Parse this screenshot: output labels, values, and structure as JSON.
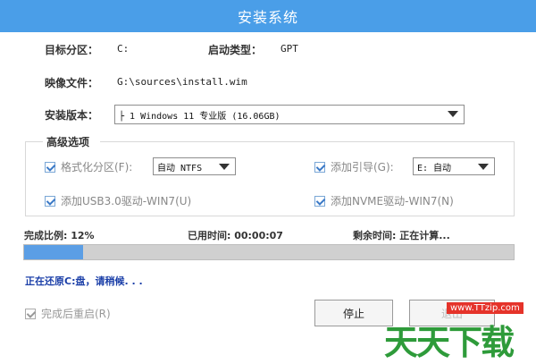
{
  "window": {
    "title": "安装系统"
  },
  "info": {
    "target_label": "目标分区：",
    "target_value": "C:",
    "boot_label": "启动类型：",
    "boot_value": "GPT",
    "image_label": "映像文件：",
    "image_value": "G:\\sources\\install.wim",
    "version_label": "安装版本：",
    "version_value": "├ 1 Windows 11 专业版 (16.06GB)"
  },
  "advanced": {
    "title": "高级选项",
    "format_label": "格式化分区(F):",
    "format_value": "自动 NTFS",
    "boot_add_label": "添加引导(G):",
    "boot_add_value": "E: 自动",
    "usb_label": "添加USB3.0驱动-WIN7(U)",
    "nvme_label": "添加NVME驱动-WIN7(N)"
  },
  "progress": {
    "ratio_text": "完成比例: 12%",
    "ratio": 0.12,
    "elapsed_text": "已用时间:  00:00:07",
    "remaining_text": "剩余时间:  正在计算...",
    "restoring_text": "正在还原C:盘，请稍候. . ."
  },
  "footer": {
    "reboot_label": "完成后重启(R)",
    "stop_label": "停止",
    "second_label": "退出"
  },
  "watermark": {
    "url": "www.TTzip.com",
    "text": "天天下载"
  },
  "colors": {
    "title_bar": "#4a9ee8",
    "progress_fill": "#5b9ee5",
    "status_blue": "#1b3fa8"
  }
}
